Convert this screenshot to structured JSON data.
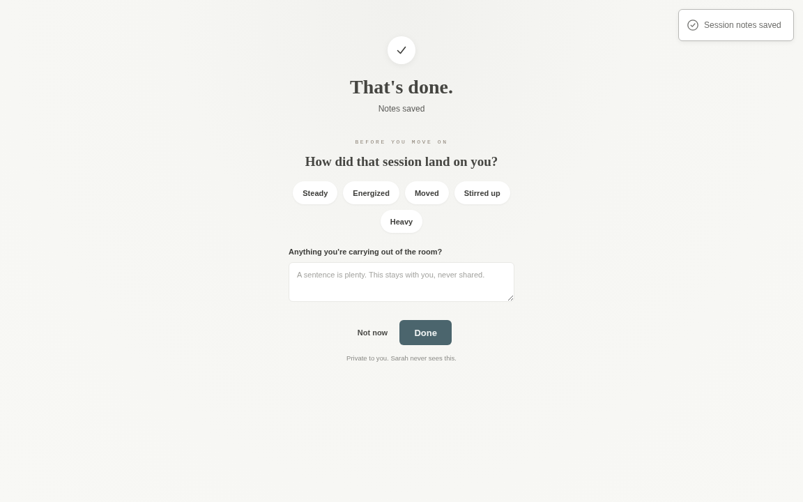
{
  "toast": {
    "message": "Session notes saved"
  },
  "confirmation": {
    "title": "That's done.",
    "subtitle": "Notes saved"
  },
  "check_in": {
    "eyebrow": "BEFORE YOU MOVE ON",
    "question": "How did that session land on you?",
    "options": [
      {
        "label": "Steady",
        "selected": false
      },
      {
        "label": "Energized",
        "selected": false
      },
      {
        "label": "Moved",
        "selected": false
      },
      {
        "label": "Stirred up",
        "selected": false
      },
      {
        "label": "Heavy",
        "selected": false
      }
    ],
    "note": {
      "label": "Anything you're carrying out of the room?",
      "placeholder": "A sentence is plenty. This stays with you, never shared."
    }
  },
  "actions": [
    {
      "label": "Not now",
      "kind": "secondary"
    },
    {
      "label": "Done",
      "kind": "primary"
    }
  ],
  "footnote": "Private to you. Sarah never sees this."
}
